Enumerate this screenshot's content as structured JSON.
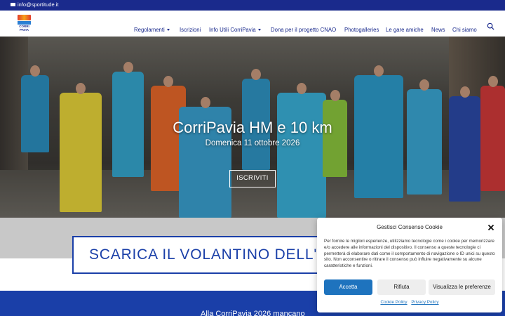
{
  "topbar": {
    "email": "info@sportitude.it"
  },
  "header": {
    "logo_text": "CORRI PAVIA",
    "nav": [
      {
        "label": "Regolamenti",
        "dropdown": true
      },
      {
        "label": "Iscrizioni",
        "dropdown": false
      },
      {
        "label": "Info Utili CorriPavia",
        "dropdown": true
      },
      {
        "label": "Dona per il progetto CNAO",
        "dropdown": false
      },
      {
        "label": "Photogalleries",
        "dropdown": false
      },
      {
        "label": "Le gare amiche",
        "dropdown": false
      },
      {
        "label": "News",
        "dropdown": false
      },
      {
        "label": "Chi siamo",
        "dropdown": false
      }
    ],
    "search_icon": "search-icon"
  },
  "hero": {
    "title": "CorriPavia HM e 10 km",
    "date": "Domenica 11 ottobre 2026",
    "button": "ISCRIVITI"
  },
  "flyer": {
    "label": "SCARICA IL VOLANTINO DELL'ED"
  },
  "countdown": {
    "label": "Alla CorriPavia 2026 mancano"
  },
  "consent": {
    "title": "Gestisci Consenso Cookie",
    "body": "Per fornire le migliori esperienze, utilizziamo tecnologie come i cookie per memorizzare e/o accedere alle informazioni del dispositivo. Il consenso a queste tecnologie ci permetterà di elaborare dati come il comportamento di navigazione o ID unici su questo sito. Non acconsentire o ritirare il consenso può influire negativamente su alcune caratteristiche e funzioni.",
    "accept": "Accetta",
    "deny": "Rifiuta",
    "preferences": "Visualizza le preferenze",
    "cookie_policy": "Cookie Policy",
    "privacy_policy": "Privacy Policy"
  },
  "colors": {
    "brand": "#1a2a8c",
    "accent": "#1e73be",
    "flyer": "#1a3fa8"
  }
}
